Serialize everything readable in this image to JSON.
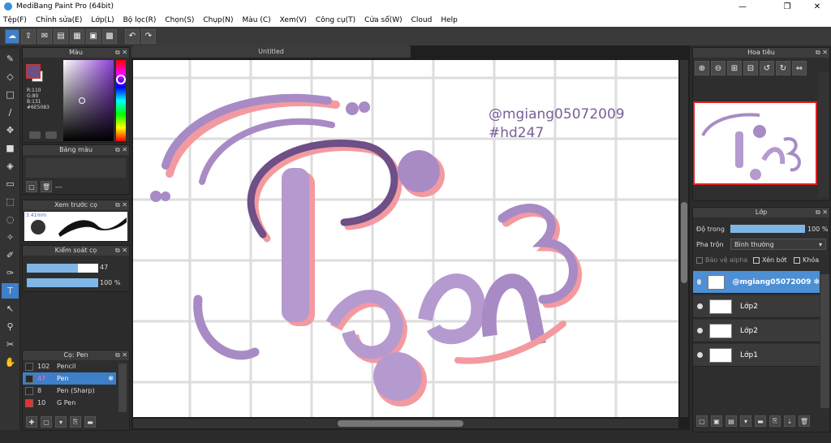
{
  "window": {
    "title": "MediBang Paint Pro (64bit)"
  },
  "menu": [
    "Tệp(F)",
    "Chỉnh sửa(E)",
    "Lớp(L)",
    "Bộ lọc(R)",
    "Chọn(S)",
    "Chụp(N)",
    "Màu (C)",
    "Xem(V)",
    "Công cụ(T)",
    "Cửa sổ(W)",
    "Cloud",
    "Help"
  ],
  "color_panel": {
    "title": "Màu",
    "r": "R:110",
    "g": "G:80",
    "b": "B:131",
    "hex": "#6E5083",
    "fg_color": "#6e5083"
  },
  "palette_panel": {
    "title": "Bảng màu",
    "dash": "---"
  },
  "preview_panel": {
    "title": "Xem trước cọ",
    "size": "3.41mm"
  },
  "brush_control": {
    "title": "Kiểm soát cọ",
    "size": "47",
    "opacity": "100 %",
    "size_fraction": 0.72,
    "opacity_fraction": 1.0
  },
  "brush_panel": {
    "title": "Cọ: Pen",
    "brushes": [
      {
        "size": "102",
        "name": "Pencil",
        "color": "#2a2a2a",
        "selected": false
      },
      {
        "size": "47",
        "name": "Pen",
        "color": "#2a2a2a",
        "selected": true
      },
      {
        "size": "8",
        "name": "Pen (Sharp)",
        "color": "#2a2a2a",
        "selected": false
      },
      {
        "size": "10",
        "name": "G Pen",
        "color": "#e53030",
        "selected": false
      }
    ]
  },
  "document": {
    "tab": "Untitled"
  },
  "canvas_text": {
    "handle": "@mgiang05072009",
    "hashtag": "#hd247"
  },
  "navigator": {
    "title": "Hoa tiêu"
  },
  "layers": {
    "title": "Lớp",
    "opacity_label": "Độ trong",
    "opacity_value": "100 %",
    "blend_label": "Pha trộn",
    "blend_value": "Bình thường",
    "protect_alpha": "Bảo vệ alpha",
    "clipping": "Xén bớt",
    "lock": "Khóa",
    "items": [
      {
        "name": "@mgiang05072009",
        "selected": true
      },
      {
        "name": "Lớp2",
        "selected": false
      },
      {
        "name": "Lớp2",
        "selected": false
      },
      {
        "name": "Lớp1",
        "selected": false
      }
    ]
  }
}
